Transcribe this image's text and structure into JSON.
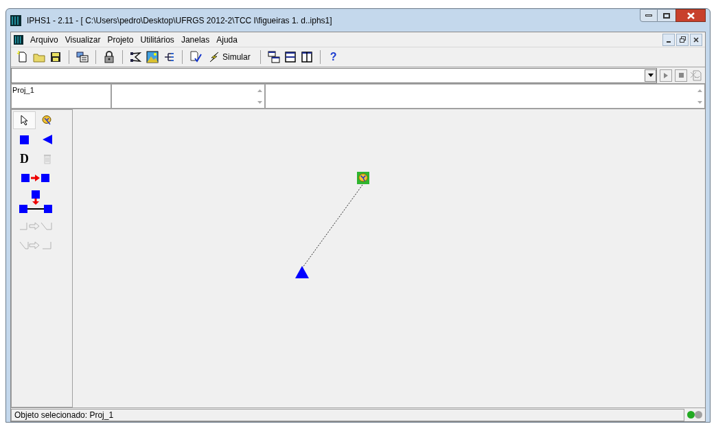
{
  "window": {
    "title": "IPHS1 - 2.11 - [ C:\\Users\\pedro\\Desktop\\UFRGS 2012-2\\TCC I\\figueiras 1. d..iphs1]"
  },
  "menu": [
    "Arquivo",
    "Visualizar",
    "Projeto",
    "Utilitários",
    "Janelas",
    "Ajuda"
  ],
  "toolbar": [
    {
      "kind": "new"
    },
    {
      "kind": "open"
    },
    {
      "kind": "save"
    },
    {
      "kind": "sep"
    },
    {
      "kind": "form"
    },
    {
      "kind": "sep"
    },
    {
      "kind": "lock"
    },
    {
      "kind": "sep"
    },
    {
      "kind": "network"
    },
    {
      "kind": "image"
    },
    {
      "kind": "tree"
    },
    {
      "kind": "sep"
    },
    {
      "kind": "check"
    },
    {
      "kind": "simulate",
      "label": "Simular"
    },
    {
      "kind": "sep"
    },
    {
      "kind": "cascade"
    },
    {
      "kind": "tile-h"
    },
    {
      "kind": "tile-v"
    },
    {
      "kind": "sep"
    },
    {
      "kind": "help",
      "label": "?"
    }
  ],
  "project": {
    "name": "Proj_1"
  },
  "palette": [
    {
      "kind": "pointer",
      "selected": true
    },
    {
      "kind": "basin",
      "selected": false
    },
    {
      "kind": "square",
      "selected": false
    },
    {
      "kind": "triangle",
      "selected": false
    },
    {
      "kind": "letter",
      "label": "D",
      "selected": false
    },
    {
      "kind": "trash",
      "disabled": true,
      "selected": false
    },
    {
      "kind": "link",
      "selected": false
    },
    {
      "kind": "junction",
      "selected": false
    },
    {
      "kind": "channel-a",
      "disabled": true,
      "selected": false
    },
    {
      "kind": "channel-b",
      "disabled": true,
      "selected": false
    }
  ],
  "canvas": {
    "nodes": [
      {
        "kind": "basin"
      },
      {
        "kind": "outlet"
      }
    ]
  },
  "status": {
    "text": "Objeto selecionado: Proj_1",
    "lights": [
      {
        "color": "#22aa22"
      },
      {
        "color": "#a0a0a0"
      }
    ]
  }
}
